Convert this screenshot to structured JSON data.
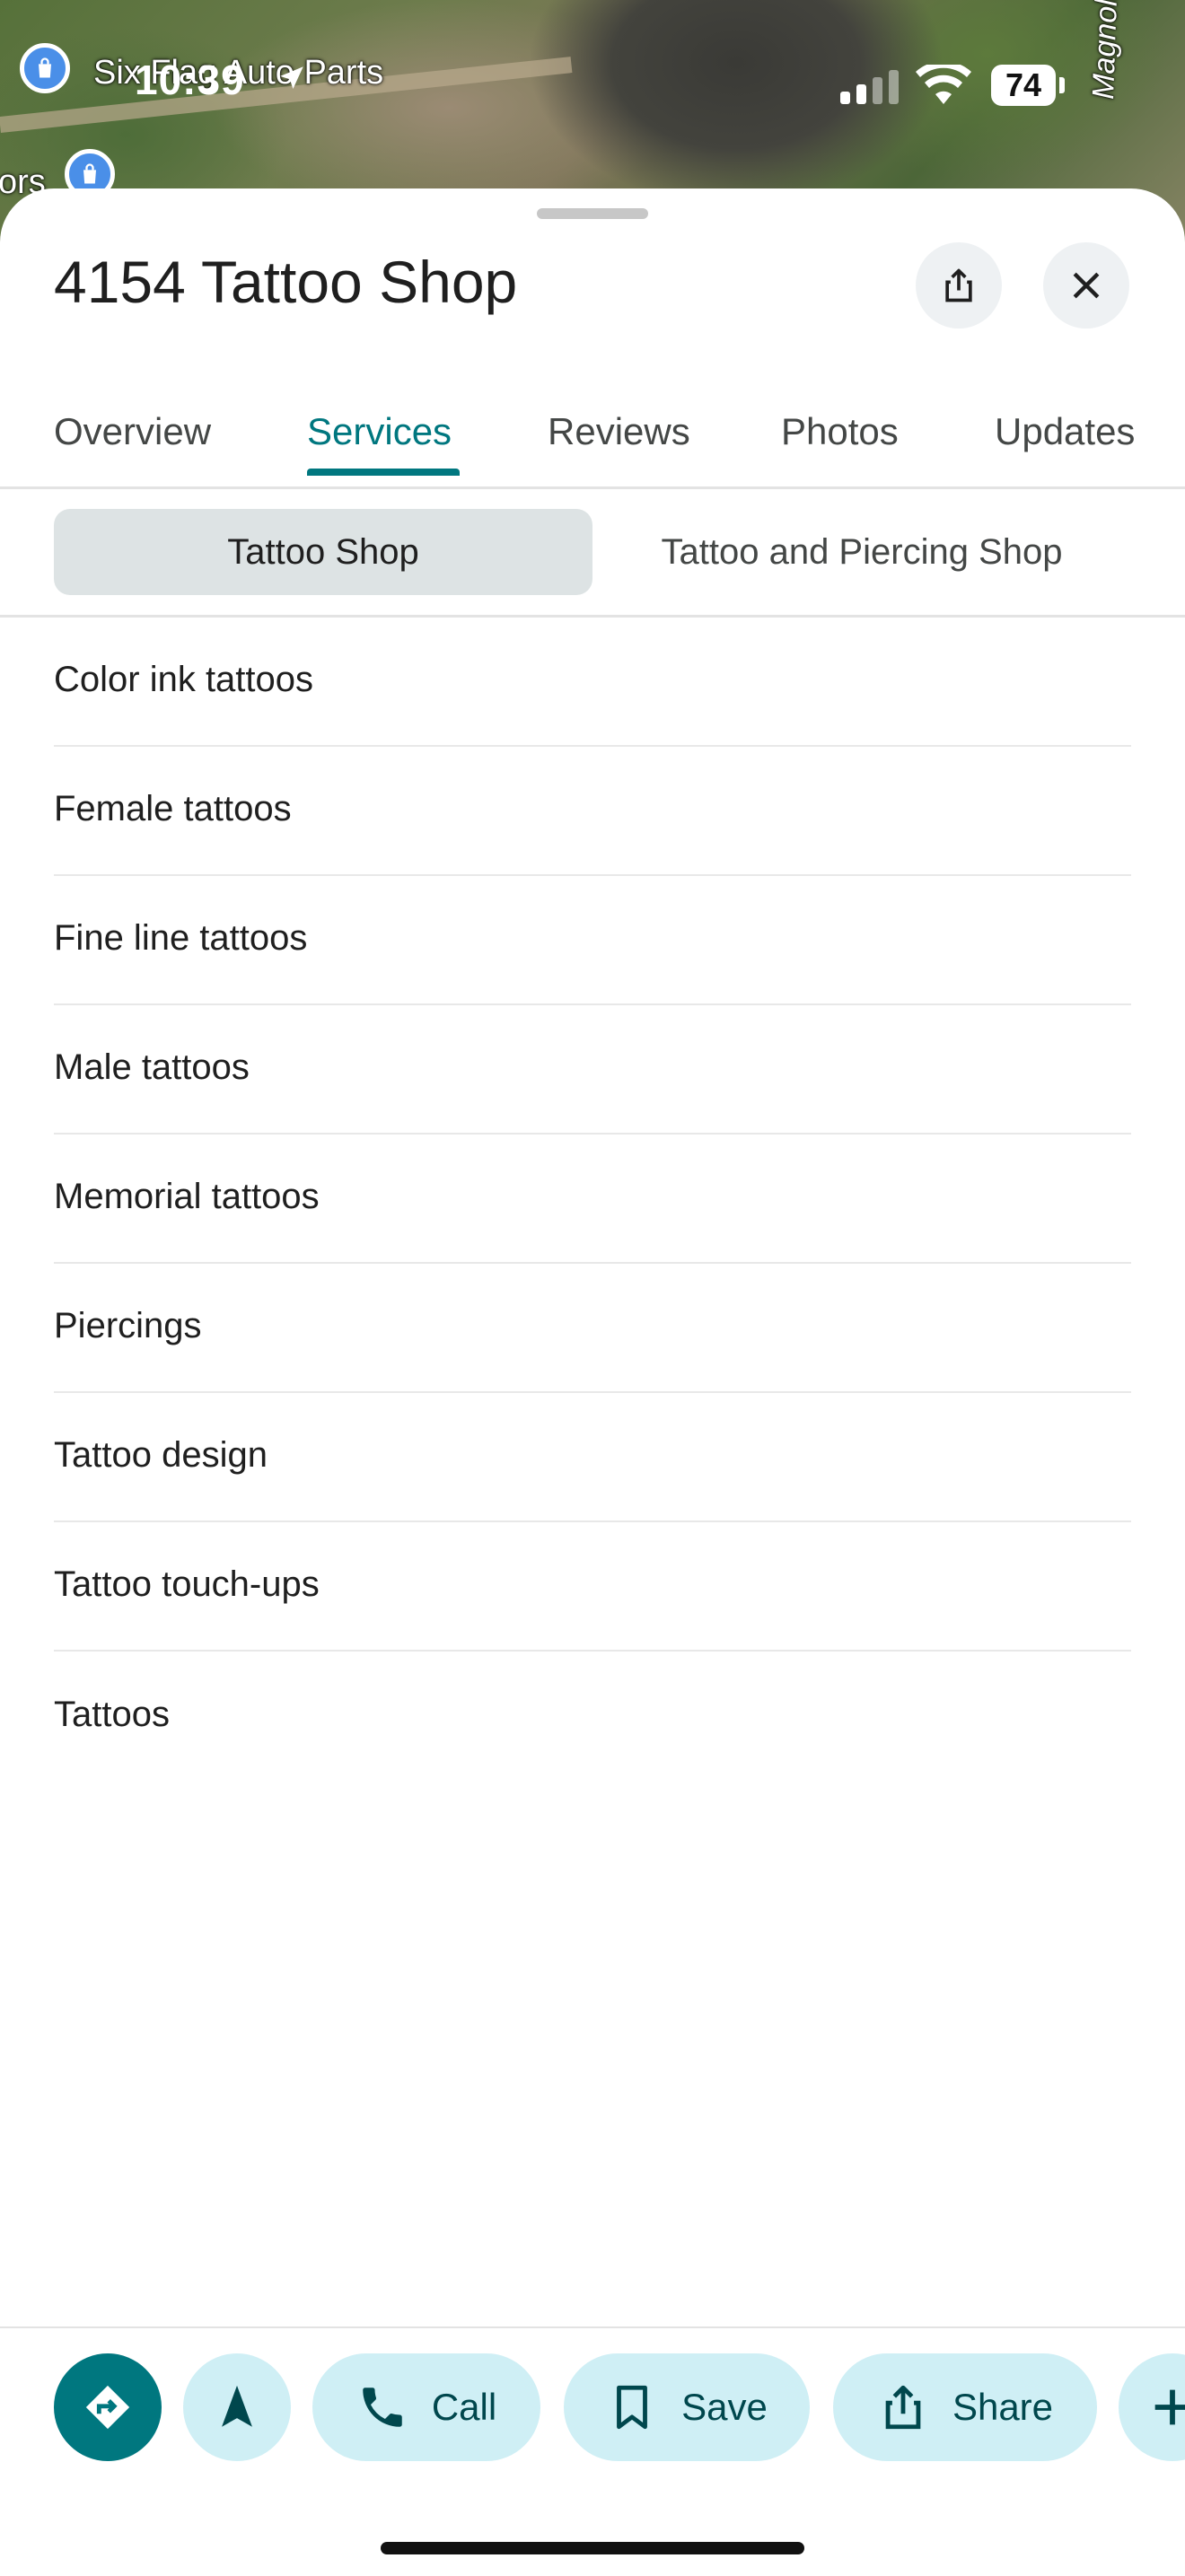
{
  "status_bar": {
    "time": "10:39",
    "battery": "74"
  },
  "map": {
    "business_label": "Six Flag Auto Parts",
    "partial_label": "ors",
    "street_label": "Magnolia Ln",
    "pin_icon": "shopping-bag-icon"
  },
  "place": {
    "title": "4154 Tattoo Shop"
  },
  "tabs": [
    {
      "label": "Overview"
    },
    {
      "label": "Services"
    },
    {
      "label": "Reviews"
    },
    {
      "label": "Photos"
    },
    {
      "label": "Updates"
    }
  ],
  "active_tab": "Services",
  "chips": [
    {
      "label": "Tattoo Shop",
      "selected": true
    },
    {
      "label": "Tattoo and Piercing Shop",
      "selected": false
    }
  ],
  "services": [
    "Color ink tattoos",
    "Female tattoos",
    "Fine line tattoos",
    "Male tattoos",
    "Memorial tattoos",
    "Piercings",
    "Tattoo design",
    "Tattoo touch-ups",
    "Tattoos"
  ],
  "actions": {
    "directions_icon": "directions-icon",
    "start_icon": "navigation-arrow-icon",
    "call": "Call",
    "save": "Save",
    "share": "Share",
    "more_icon": "plus-icon"
  },
  "colors": {
    "accent": "#00777f",
    "chip_selected_bg": "#dde3e4",
    "action_bg": "#cfeff5"
  }
}
